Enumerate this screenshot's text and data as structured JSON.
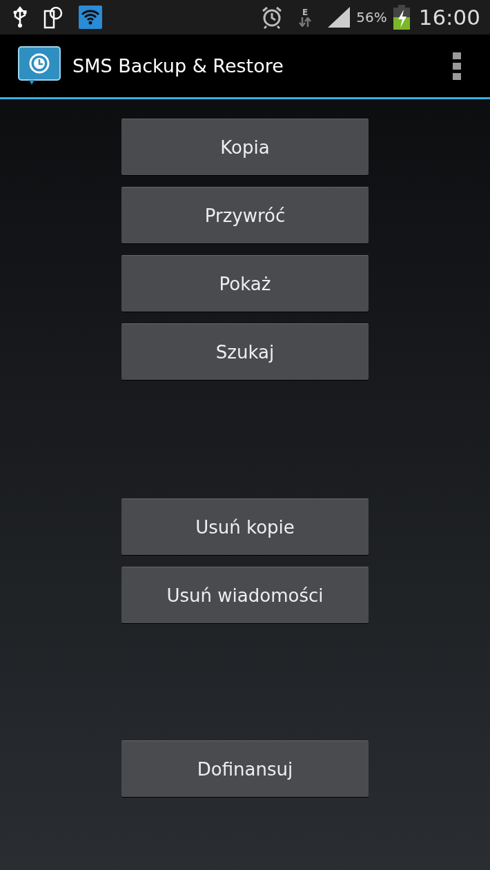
{
  "status_bar": {
    "network_type": "E",
    "battery": "56%",
    "time": "16:00"
  },
  "action_bar": {
    "title": "SMS Backup & Restore"
  },
  "button_groups": [
    {
      "buttons": [
        "Kopia",
        "Przywróć",
        "Pokaż",
        "Szukaj"
      ]
    },
    {
      "buttons": [
        "Usuń kopie",
        "Usuń wiadomości"
      ]
    },
    {
      "buttons": [
        "Dofinansuj"
      ]
    }
  ]
}
